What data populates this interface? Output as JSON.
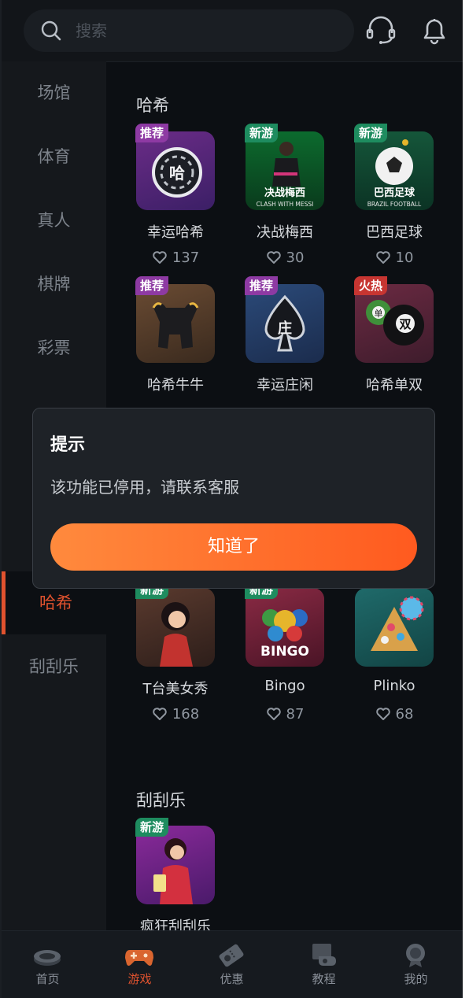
{
  "search": {
    "placeholder": "搜索"
  },
  "sidebar": {
    "items": [
      {
        "label": "场馆"
      },
      {
        "label": "体育"
      },
      {
        "label": "真人"
      },
      {
        "label": "棋牌"
      },
      {
        "label": "彩票"
      },
      {
        "label": "哈希"
      },
      {
        "label": "刮刮乐"
      }
    ]
  },
  "sections": [
    {
      "title": "哈希",
      "games": [
        {
          "name": "幸运哈希",
          "likes": "137",
          "badge": "推荐"
        },
        {
          "name": "决战梅西",
          "likes": "30",
          "badge": "新游",
          "thumb_title": "决战梅西",
          "thumb_sub": "CLASH WITH MESSI"
        },
        {
          "name": "巴西足球",
          "likes": "10",
          "badge": "新游",
          "thumb_title": "巴西足球",
          "thumb_sub": "BRAZIL FOOTBALL"
        },
        {
          "name": "哈希牛牛",
          "likes": "",
          "badge": "推荐"
        },
        {
          "name": "幸运庄闲",
          "likes": "",
          "badge": "推荐",
          "thumb_char": "庄"
        },
        {
          "name": "哈希单双",
          "likes": "",
          "badge": "火热",
          "thumb_char1": "单",
          "thumb_char2": "双"
        },
        {
          "name": "T台美女秀",
          "likes": "168",
          "badge": "新游"
        },
        {
          "name": "Bingo",
          "likes": "87",
          "badge": "新游",
          "thumb_text": "BINGO"
        },
        {
          "name": "Plinko",
          "likes": "68",
          "badge": ""
        }
      ]
    },
    {
      "title": "刮刮乐",
      "games": [
        {
          "name": "疯狂刮刮乐",
          "likes": "",
          "badge": "新游"
        }
      ]
    }
  ],
  "dialog": {
    "title": "提示",
    "message": "该功能已停用，请联系客服",
    "button": "知道了"
  },
  "bottom_nav": [
    {
      "label": "首页",
      "icon": "stadium-icon"
    },
    {
      "label": "游戏",
      "icon": "gamepad-icon"
    },
    {
      "label": "优惠",
      "icon": "ticket-icon"
    },
    {
      "label": "教程",
      "icon": "whistle-icon"
    },
    {
      "label": "我的",
      "icon": "trophy-icon"
    }
  ],
  "colors": {
    "accent": "#e0522e",
    "button_start": "#ff8a3d",
    "button_end": "#ff5a1f"
  }
}
